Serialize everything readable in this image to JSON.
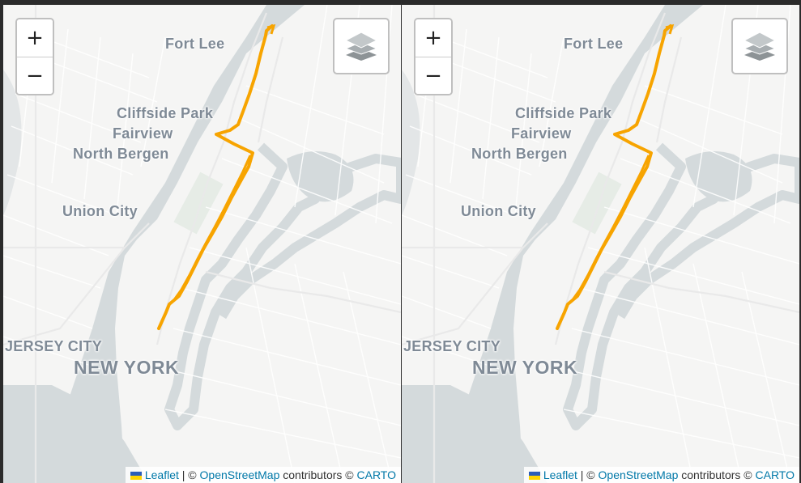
{
  "zoom": {
    "in_label": "+",
    "out_label": "−"
  },
  "places": {
    "fort_lee": "Fort Lee",
    "cliffside_park": "Cliffside Park",
    "fairview": "Fairview",
    "north_bergen": "North Bergen",
    "union_city": "Union City",
    "jersey_city": "JERSEY CITY",
    "new_york": "NEW YORK"
  },
  "attribution": {
    "leaflet": "Leaflet",
    "sep1": " | © ",
    "osm": "OpenStreetMap",
    "contributors": " contributors © ",
    "carto": "CARTO"
  },
  "route_color": "#f7a400",
  "icons": [
    "layers-icon",
    "ukraine-flag-icon"
  ]
}
